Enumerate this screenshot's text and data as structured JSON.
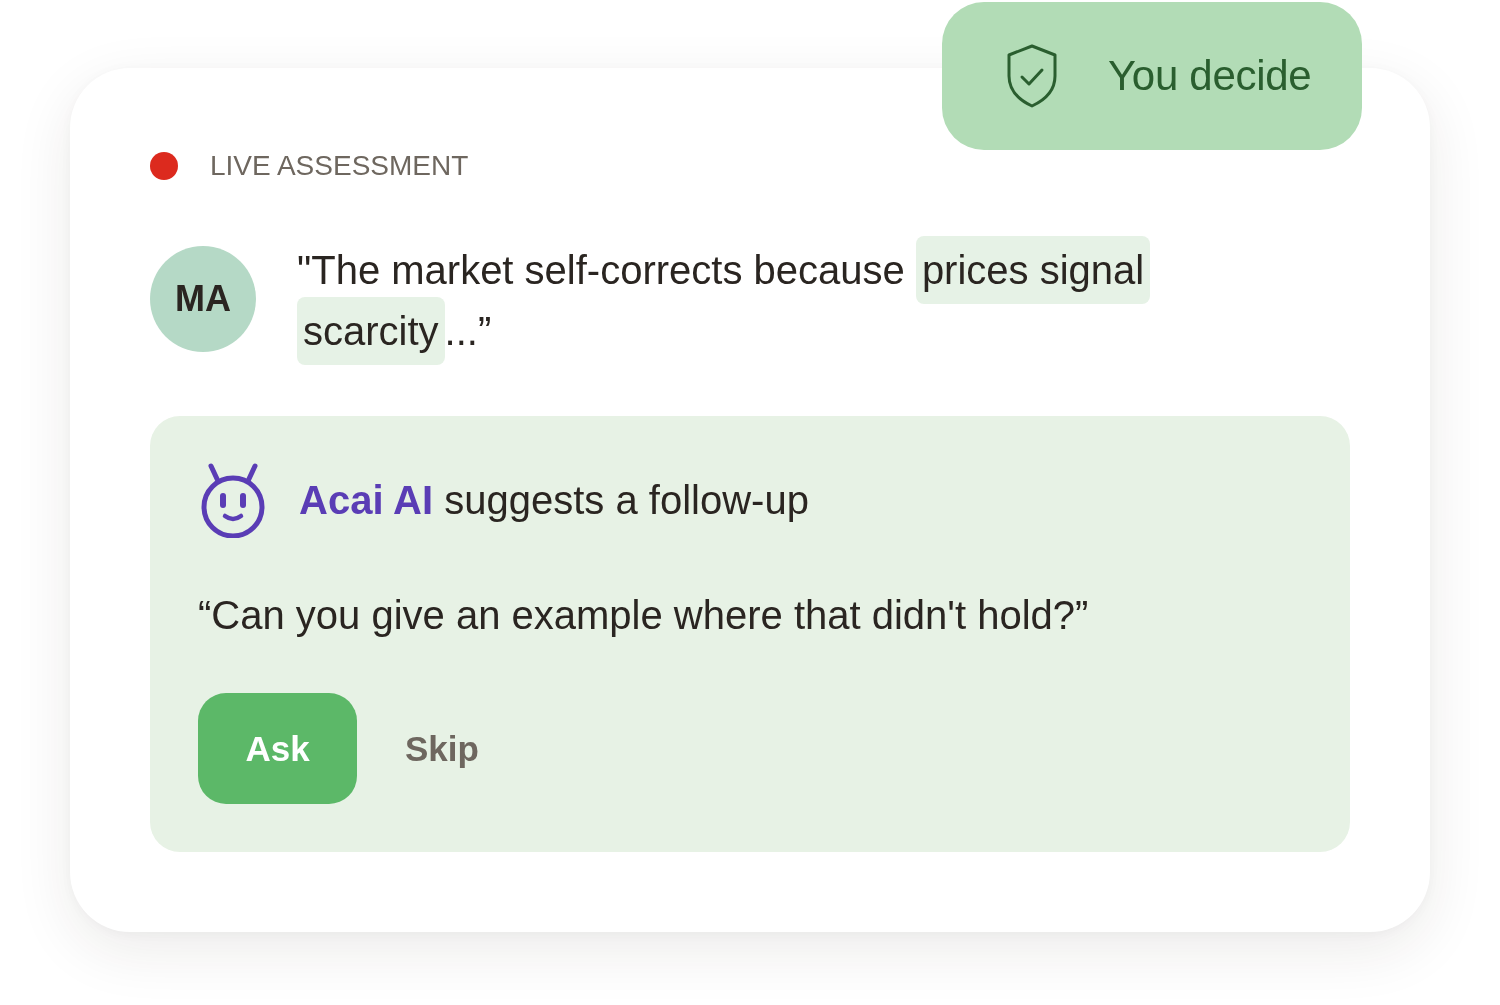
{
  "badge": {
    "label": "You decide"
  },
  "status": {
    "label": "LIVE ASSESSMENT",
    "live": true
  },
  "speaker": {
    "initials": "MA",
    "quote": [
      {
        "text": "\"The market self-corrects because ",
        "highlighted": false
      },
      {
        "text": "prices signal scarcity",
        "highlighted": true
      },
      {
        "text": "...”",
        "highlighted": false
      }
    ]
  },
  "suggestion": {
    "title": "**Acai AI** suggests a follow-up",
    "question": "“Can you give an example where that didn't hold?”",
    "actions": [
      {
        "label": "Ask",
        "kind": "primary"
      },
      {
        "label": "Skip",
        "kind": "text"
      }
    ]
  }
}
